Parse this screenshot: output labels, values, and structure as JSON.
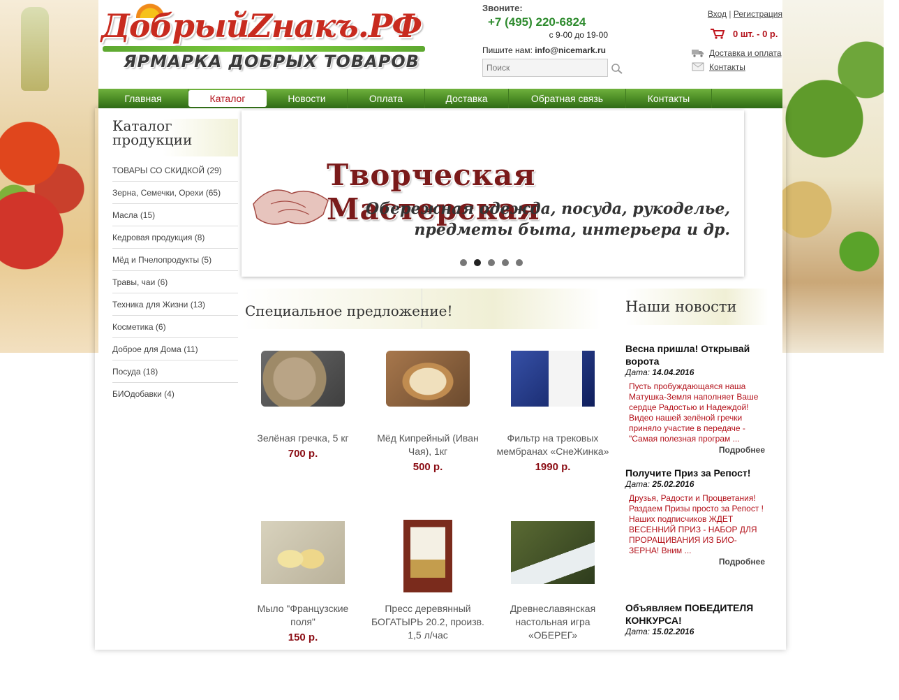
{
  "header": {
    "logo_main": "ДобрыйZнакъ.РФ",
    "logo_sub": "ЯРМАРКА ДОБРЫХ ТОВАРОВ",
    "call_label": "Звоните:",
    "phone": "+7 (495) 220-6824",
    "hours": "с 9-00 до 19-00",
    "write_label": "Пишите нам:",
    "email": "info@nicemark.ru",
    "search_placeholder": "Поиск",
    "login": "Вход",
    "separator": "|",
    "register": "Регистрация",
    "cart": "0 шт. - 0 р.",
    "delivery_link": "Доставка и оплата",
    "contacts_link": "Контакты"
  },
  "nav": {
    "items": [
      {
        "label": "Главная"
      },
      {
        "label": "Каталог"
      },
      {
        "label": "Новости"
      },
      {
        "label": "Оплата"
      },
      {
        "label": "Доставка"
      },
      {
        "label": "Обратная связь"
      },
      {
        "label": "Контакты"
      }
    ],
    "active_index": 1
  },
  "sidebar": {
    "title": "Каталог продукции",
    "items": [
      "ТОВАРЫ СО СКИДКОЙ (29)",
      "Зерна, Семечки, Орехи (65)",
      "Масла (15)",
      "Кедровая продукция (8)",
      "Мёд и Пчелопродукты (5)",
      "Травы, чаи (6)",
      "Техника для Жизни (13)",
      "Косметика (6)",
      "Доброе для Дома (11)",
      "Посуда (18)",
      "БИОдобавки (4)"
    ]
  },
  "slider": {
    "title": "Творческая Мастерская",
    "subtitle_line1": "Обережная одежда, посуда, рукоделье,",
    "subtitle_line2": "предметы быта, интерьера и др.",
    "dots": 5,
    "active_dot": 1
  },
  "special": {
    "title": "Специальное предложение!",
    "products": [
      {
        "name": "Зелёная гречка, 5 кг",
        "price": "700 р."
      },
      {
        "name": "Мёд Кипрейный (Иван Чая), 1кг",
        "price": "500 р."
      },
      {
        "name": "Фильтр на трековых мембранах «СнеЖинка»",
        "price": "1990 р."
      },
      {
        "name": "Мыло \"Французские поля\"",
        "price": "150 р."
      },
      {
        "name": "Пресс деревянный БОГАТЫРЬ 20.2, произв. 1,5 л/час",
        "price": ""
      },
      {
        "name": "Древнеславянская настольная игра «ОБЕРЕГ»",
        "price": ""
      }
    ]
  },
  "news": {
    "title": "Наши новости",
    "date_label": "Дата:",
    "more_label": "Подробнее",
    "items": [
      {
        "title": "Весна пришла! Открывай ворота",
        "date": "14.04.2016",
        "body": "Пусть пробуждающаяся наша Матушка-Земля наполняет Ваше сердце Радостью и Надеждой! Видео нашей зелёной гречки приняло участие в передаче - \"Самая полезная програм ..."
      },
      {
        "title": "Получите Приз за Репост!",
        "date": "25.02.2016",
        "body": "Друзья, Радости и Процветания! Раздаем Призы просто за Репост ! Наших подписчиков ЖДЕТ ВЕСЕННИЙ ПРИЗ - НАБОР ДЛЯ ПРОРАЩИВАНИЯ ИЗ БИО-ЗЕРНА! Вним ..."
      },
      {
        "title": "Объявляем ПОБЕДИТЕЛЯ КОНКУРСА!",
        "date": "15.02.2016",
        "body": ""
      }
    ]
  }
}
